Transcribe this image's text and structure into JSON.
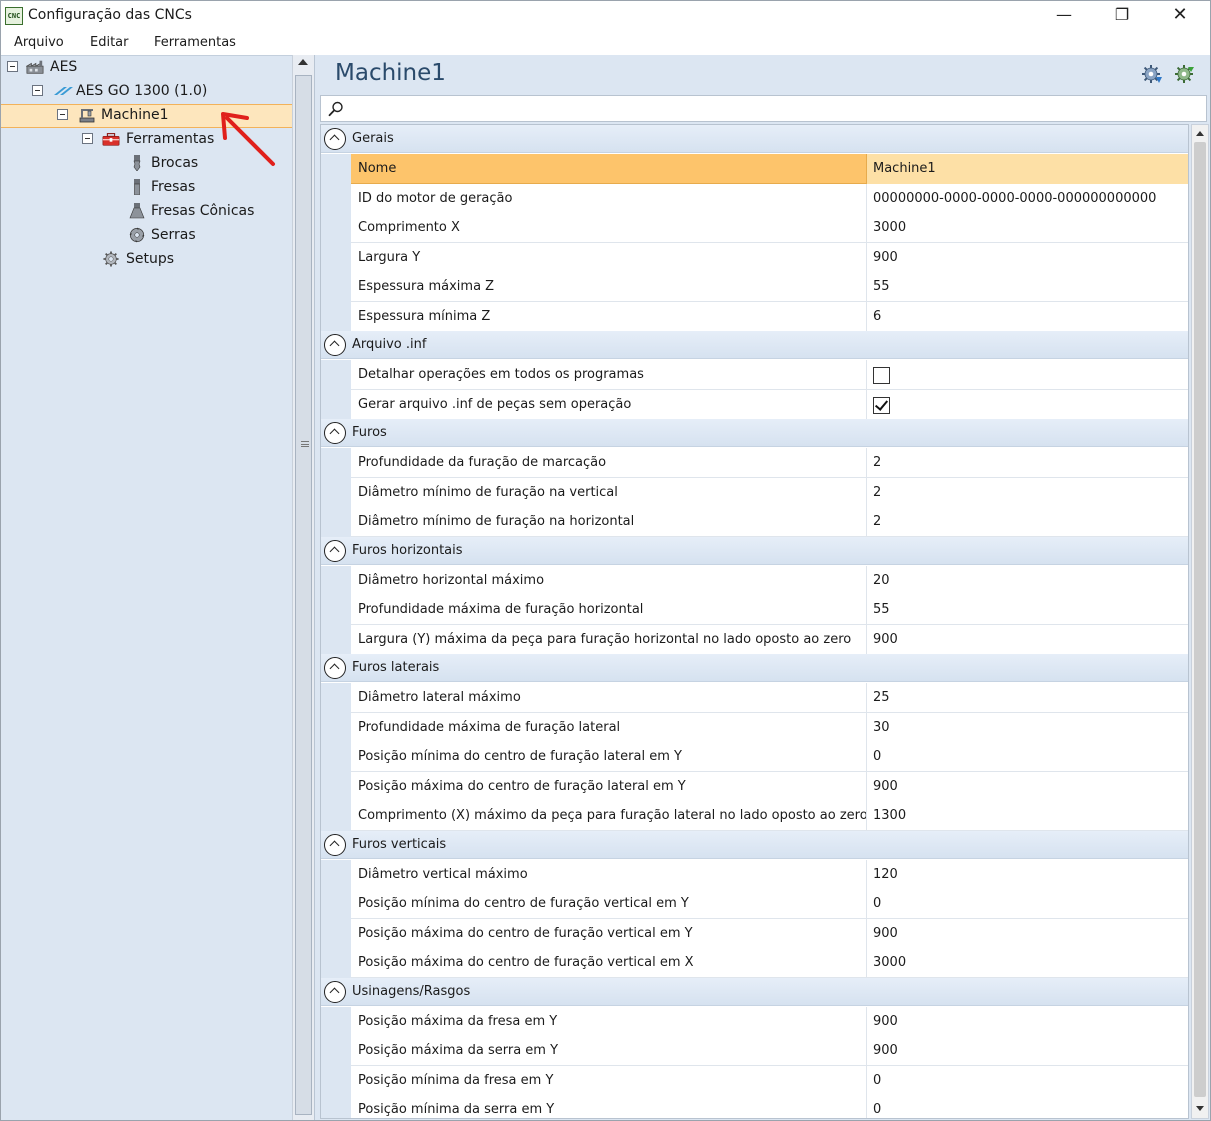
{
  "window": {
    "title": "Configuração das CNCs",
    "app_icon_text": "CNC",
    "minimize": "—",
    "maximize": "❐",
    "close": "✕"
  },
  "menu": [
    "Arquivo",
    "Editar",
    "Ferramentas"
  ],
  "tree": {
    "root": "AES",
    "machine_group": "AES GO 1300 (1.0)",
    "machine": "Machine1",
    "tools": "Ferramentas",
    "tool_items": [
      "Brocas",
      "Fresas",
      "Fresas Cônicas",
      "Serras"
    ],
    "setups": "Setups",
    "selected": "Machine1"
  },
  "panel": {
    "title": "Machine1",
    "search_value": ""
  },
  "categories": [
    {
      "name": "Gerais",
      "rows": [
        {
          "name": "Nome",
          "value": "Machine1",
          "selected": true
        },
        {
          "name": "ID do motor de geração",
          "value": "00000000-0000-0000-0000-000000000000"
        },
        {
          "name": "Comprimento X",
          "value": "3000"
        },
        {
          "name": "Largura Y",
          "value": "900"
        },
        {
          "name": "Espessura máxima Z",
          "value": "55"
        },
        {
          "name": "Espessura mínima Z",
          "value": "6"
        }
      ]
    },
    {
      "name": "Arquivo .inf",
      "rows": [
        {
          "name": "Detalhar operações em todos os programas",
          "checkbox": true,
          "checked": false
        },
        {
          "name": "Gerar arquivo .inf de peças sem operação",
          "checkbox": true,
          "checked": true
        }
      ]
    },
    {
      "name": "Furos",
      "rows": [
        {
          "name": "Profundidade da furação de marcação",
          "value": "2"
        },
        {
          "name": "Diâmetro mínimo de furação na vertical",
          "value": "2"
        },
        {
          "name": "Diâmetro mínimo de furação na horizontal",
          "value": "2"
        }
      ]
    },
    {
      "name": "Furos horizontais",
      "rows": [
        {
          "name": "Diâmetro horizontal máximo",
          "value": "20"
        },
        {
          "name": "Profundidade máxima de furação horizontal",
          "value": "55"
        },
        {
          "name": "Largura (Y) máxima da peça para furação horizontal no lado oposto ao zero",
          "value": "900"
        }
      ]
    },
    {
      "name": "Furos laterais",
      "rows": [
        {
          "name": "Diâmetro lateral máximo",
          "value": "25"
        },
        {
          "name": "Profundidade máxima de furação lateral",
          "value": "30"
        },
        {
          "name": "Posição mínima do centro de furação lateral em Y",
          "value": "0"
        },
        {
          "name": "Posição máxima do centro de furação lateral em Y",
          "value": "900"
        },
        {
          "name": "Comprimento (X) máximo da peça para furação lateral no lado oposto ao zero",
          "value": "1300"
        }
      ]
    },
    {
      "name": "Furos verticais",
      "rows": [
        {
          "name": "Diâmetro vertical máximo",
          "value": "120"
        },
        {
          "name": "Posição mínima do centro de furação vertical em Y",
          "value": "0"
        },
        {
          "name": "Posição máxima do centro de furação vertical em Y",
          "value": "900"
        },
        {
          "name": "Posição máxima do centro de furação vertical em X",
          "value": "3000"
        }
      ]
    },
    {
      "name": "Usinagens/Rasgos",
      "rows": [
        {
          "name": "Posição máxima da fresa em Y",
          "value": "900"
        },
        {
          "name": "Posição máxima da serra em Y",
          "value": "900"
        },
        {
          "name": "Posição mínima da fresa em Y",
          "value": "0"
        },
        {
          "name": "Posição mínima da serra em Y",
          "value": "0"
        }
      ]
    }
  ],
  "colors": {
    "panel_bg": "#dce6f2",
    "selection": "#fdc46b",
    "tree_selection": "#fde6bd",
    "title_blue": "#2a4a6b",
    "annotation_red": "#e0201b"
  }
}
